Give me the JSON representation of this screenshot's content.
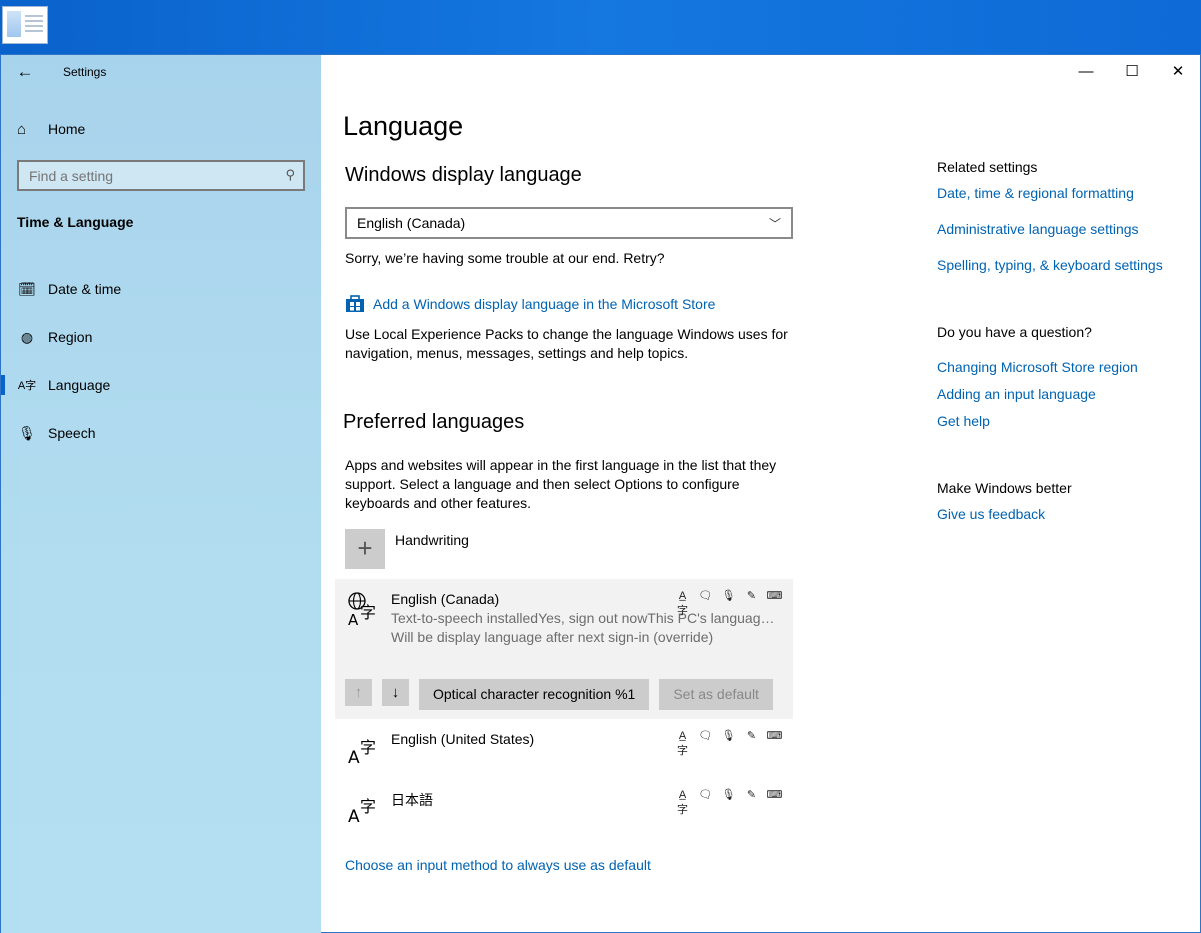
{
  "window": {
    "app_title": "Settings",
    "controls": {
      "minimize": "—",
      "maximize": "☐",
      "close": "✕"
    }
  },
  "sidebar": {
    "home_label": "Home",
    "search_placeholder": "Find a setting",
    "section_title": "Time & Language",
    "items": [
      {
        "label": "Date & time",
        "icon": "calendar-clock-icon"
      },
      {
        "label": "Region",
        "icon": "globe-icon"
      },
      {
        "label": "Language",
        "icon": "language-icon",
        "active": true
      },
      {
        "label": "Speech",
        "icon": "microphone-icon"
      }
    ]
  },
  "main": {
    "title": "Language",
    "display_language": {
      "heading": "Windows display language",
      "selected": "English (Canada)",
      "error": "Sorry, we’re having some trouble at our end. Retry?",
      "store_link": "Add a Windows display language in the Microsoft Store",
      "store_desc": "Use Local Experience Packs to change the language Windows uses for navigation, menus, messages, settings and help topics."
    },
    "preferred": {
      "heading": "Preferred languages",
      "desc": "Apps and websites will appear in the first language in the list that they support. Select a language and then select Options to configure keyboards and other features.",
      "add_label": "Handwriting",
      "languages": [
        {
          "name": "English (Canada)",
          "sub1": "Text-to-speech installedYes, sign out nowThis PC's language is set to English (Canada)",
          "sub2": "Will be display language after next sign-in (override)"
        },
        {
          "name": "English (United States)"
        },
        {
          "name": "日本語"
        }
      ],
      "ocr_button": "Optical character recognition %1",
      "default_button": "Set as default"
    },
    "input_method_link": "Choose an input method to always use as default"
  },
  "related": {
    "heading": "Related settings",
    "links": [
      "Date, time & regional formatting",
      "Administrative language settings",
      "Spelling, typing, & keyboard settings"
    ],
    "question_heading": "Do you have a question?",
    "question_links": [
      "Changing Microsoft Store region",
      "Adding an input language",
      "Get help"
    ],
    "better_heading": "Make Windows better",
    "feedback_link": "Give us feedback"
  },
  "colors": {
    "accent": "#0063b1",
    "sidebar": "#b2ddf0",
    "selected_row": "#f2f2f2"
  }
}
